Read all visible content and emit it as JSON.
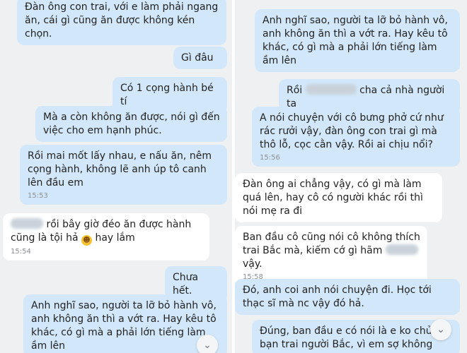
{
  "left": {
    "messages": [
      {
        "text": "Đàn ông con trai, với e làm phải ngang ăn, cái gì cũng ăn được không kén chọn."
      },
      {
        "text": "Gì đâu"
      },
      {
        "text": "Có 1 cọng hành bé tí"
      },
      {
        "text": "Mà a còn không ăn được, nói gì đến việc cho em hạnh phúc."
      },
      {
        "text": "Rồi mai mốt lấy nhau, e nấu ăn, nêm cọng hành, không lẽ anh úp tô canh lên đầu em",
        "time": "15:53"
      },
      {
        "text": "rồi bây giờ đéo ăn được hành cũng là tội hả",
        "text_after": "hay lắm",
        "time": "15:54"
      },
      {
        "text": "Chưa hết."
      },
      {
        "text": "Anh nghĩ sao, người ta lỡ bỏ hành vô, anh không ăn thì a vớt ra. Hay kêu tô khác, có gì mà a phải lớn tiếng làm ầm lên"
      }
    ]
  },
  "right": {
    "messages": [
      {
        "text": "Anh nghĩ sao, người ta lỡ bỏ hành vô, anh không ăn thì a vớt ra. Hay kêu tô khác, có gì mà a phải lớn tiếng làm ầm lên"
      },
      {
        "text_before": "Rồi",
        "text": "cha cả nhà người ta"
      },
      {
        "text": "A nói chuyện với cô bưng phở cứ như rác rưởi vậy, đàn ông con trai gì mà thô lỗ, cọc cằn vậy. Rồi ai chịu nổi?",
        "time": "15:56"
      },
      {
        "text": "Đàn ông ai chẳng vậy, có gì mà làm quá lên, hay cô có người khác rồi thì nói mẹ ra đi"
      },
      {
        "text": "Ban đầu cô cũng nói cô không thích trai Bắc mà, kiếm cớ gì hãm",
        "text_after": "vậy.",
        "time": "15:58"
      },
      {
        "text": "Đó, anh coi anh nói chuyện đi. Học tới thạc sĩ mà nc vậy đó hả."
      },
      {
        "text": "Đúng, ban đầu e có nói là e ko chủ tìm bạn trai người Bắc, vì em sợ không"
      }
    ]
  },
  "icons": {
    "scroll_down": "chevron-down-icon",
    "reaction": "smiling-face-icon"
  },
  "glyphs": {
    "chevron": "⌄",
    "smile": "☻"
  },
  "colors": {
    "outgoing_bubble": "#d2e8fa",
    "incoming_bubble": "#ffffff",
    "background": "#eef0f2"
  }
}
